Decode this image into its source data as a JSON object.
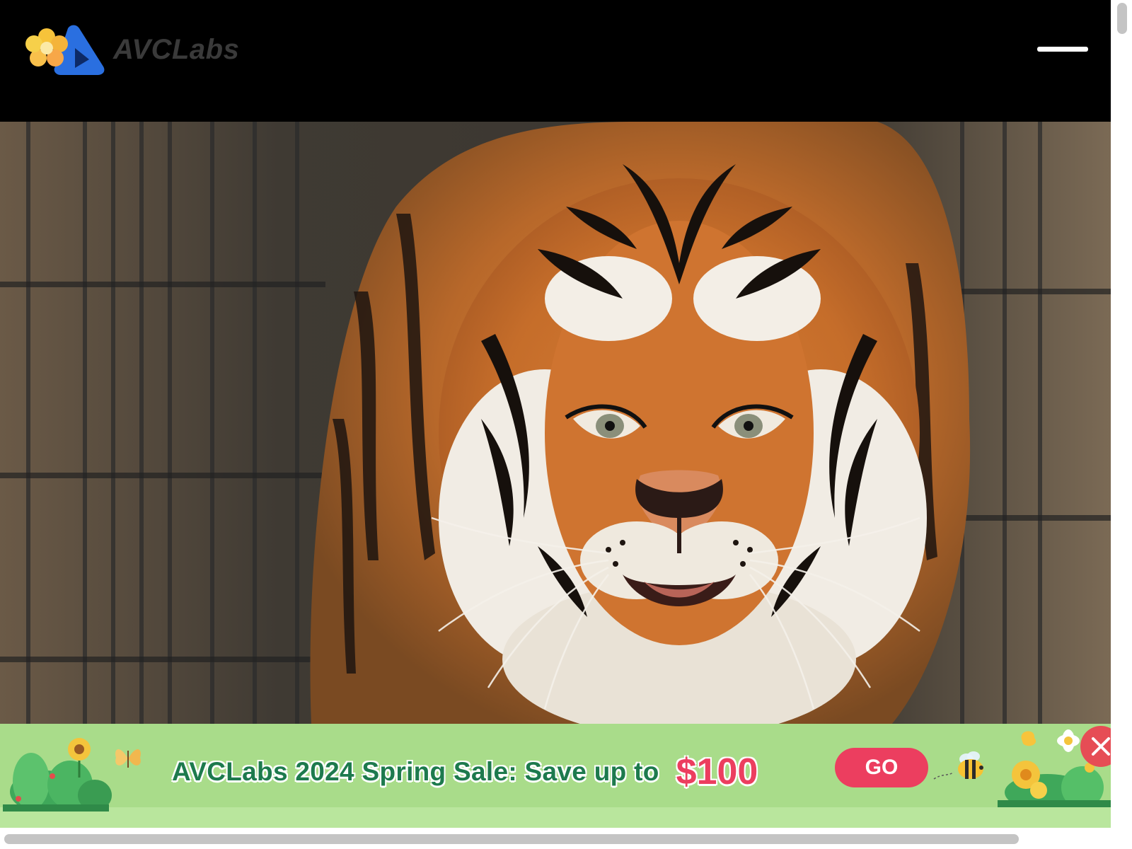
{
  "header": {
    "brand_name": "AVCLabs",
    "logo_icon": "avclabs-flower-play-logo",
    "menu_icon": "hamburger-menu-icon"
  },
  "hero": {
    "image": "tiger-photo"
  },
  "promo": {
    "message": "AVCLabs 2024 Spring Sale: Save up to",
    "amount": "$100",
    "go_label": "GO",
    "close_icon": "close-icon",
    "colors": {
      "background": "#a9dc8a",
      "message": "#1d7a4d",
      "accent": "#ec3e5f"
    }
  },
  "scrollbars": {
    "vertical": "vertical-scrollbar",
    "horizontal": "horizontal-scrollbar"
  }
}
